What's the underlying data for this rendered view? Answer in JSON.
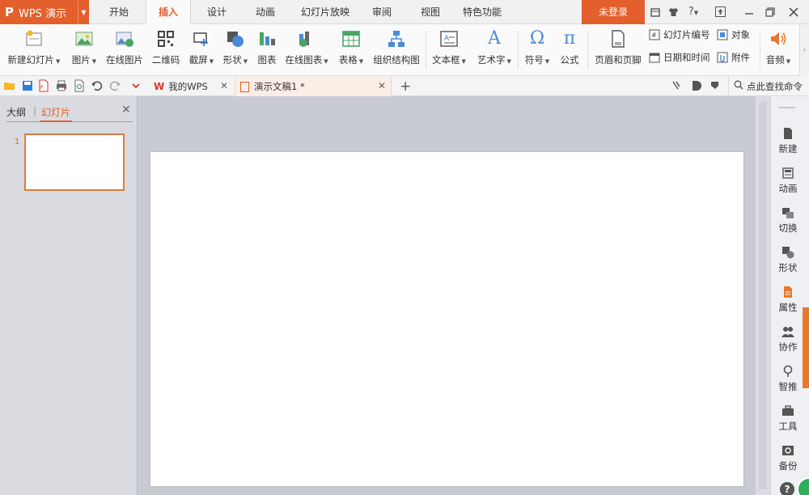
{
  "app": {
    "name": "WPS 演示",
    "logo": "P"
  },
  "menu_tabs": [
    "开始",
    "插入",
    "设计",
    "动画",
    "幻灯片放映",
    "审阅",
    "视图",
    "特色功能"
  ],
  "login_label": "未登录",
  "window_controls": {
    "help": "?"
  },
  "ribbon": {
    "new_slide": "新建幻灯片",
    "picture": "图片",
    "online_picture": "在线图片",
    "qrcode": "二维码",
    "screenshot": "截屏",
    "shape": "形状",
    "chart": "图表",
    "online_chart": "在线图表",
    "table": "表格",
    "org_chart": "组织结构图",
    "textbox": "文本框",
    "wordart": "艺术字",
    "symbol": "符号",
    "equation": "公式",
    "equation_glyph": "π",
    "symbol_glyph": "Ω",
    "wordart_glyph": "A",
    "header_footer": "页眉和页脚",
    "slide_number": "幻灯片编号",
    "object": "对象",
    "datetime": "日期和时间",
    "attachment": "附件",
    "audio": "音频"
  },
  "doc_tabs": {
    "home": "我的WPS",
    "doc": "演示文稿1 *",
    "new_tab": "+"
  },
  "search_command": "点此查找命令",
  "left_panel": {
    "tab_outline": "大纲",
    "tab_slides": "幻灯片",
    "slide_number": "1"
  },
  "right_pane": [
    {
      "label": "新建",
      "icon": "new-doc-icon"
    },
    {
      "label": "动画",
      "icon": "animation-icon"
    },
    {
      "label": "切换",
      "icon": "transition-icon"
    },
    {
      "label": "形状",
      "icon": "shape-icon"
    },
    {
      "label": "属性",
      "icon": "properties-icon"
    },
    {
      "label": "协作",
      "icon": "collaborate-icon"
    },
    {
      "label": "智推",
      "icon": "smart-push-icon"
    },
    {
      "label": "工具",
      "icon": "tools-icon"
    },
    {
      "label": "备份",
      "icon": "backup-icon"
    }
  ],
  "colors": {
    "accent": "#e35f2b",
    "ribbon_bg": "#fafafa",
    "workspace_bg": "#c9cbd2"
  }
}
